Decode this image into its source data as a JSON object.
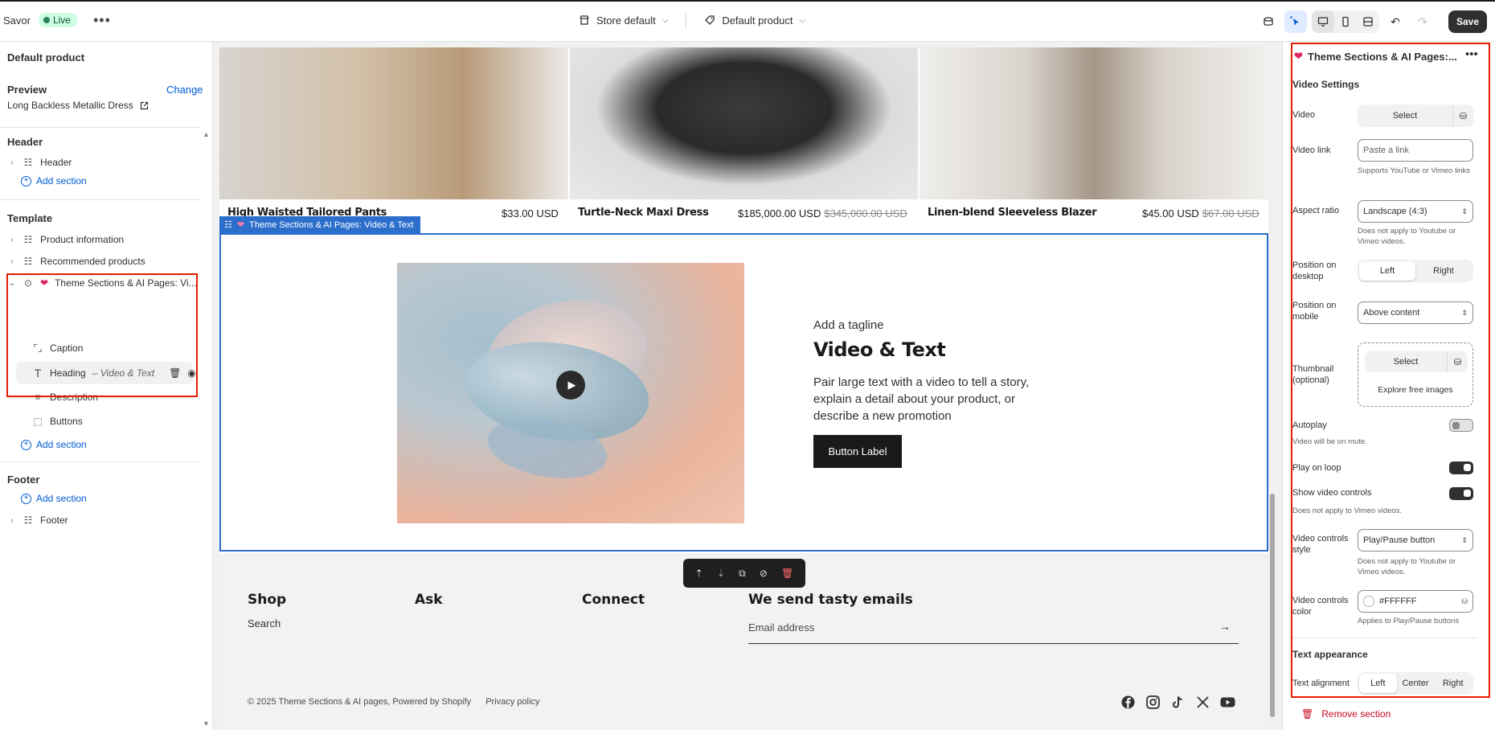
{
  "topbar": {
    "theme_name": "Savor",
    "status_badge": "Live",
    "store_dropdown": "Store default",
    "template_dropdown": "Default product",
    "save_label": "Save"
  },
  "left_panel": {
    "title": "Default product",
    "preview_label": "Preview",
    "change_label": "Change",
    "preview_product": "Long Backless Metallic Dress",
    "header_group": "Header",
    "header_item": "Header",
    "add_section": "Add section",
    "template_group": "Template",
    "template_items": [
      "Product information",
      "Recommended products",
      "Theme Sections & AI Pages: Vi..."
    ],
    "blocks": [
      {
        "label": "Caption"
      },
      {
        "label": "Heading",
        "suffix": "– Video & Text"
      },
      {
        "label": "Description"
      },
      {
        "label": "Buttons"
      }
    ],
    "footer_group": "Footer",
    "footer_item": "Footer"
  },
  "canvas": {
    "products": [
      {
        "name": "High Waisted Tailored Pants",
        "price": "$33.00 USD",
        "compare": ""
      },
      {
        "name": "Turtle-Neck Maxi Dress",
        "price": "$185,000.00 USD",
        "compare": "$345,000.00 USD"
      },
      {
        "name": "Linen-blend Sleeveless Blazer",
        "price": "$45.00 USD",
        "compare": "$67.00 USD"
      }
    ],
    "section_tag": "Theme Sections & AI Pages: Video & Text",
    "tagline": "Add a tagline",
    "heading": "Video & Text",
    "description": "Pair large text with a video to tell a story, explain a detail about your product, or describe a new promotion",
    "button_label": "Button Label",
    "footer": {
      "col_shop": "Shop",
      "shop_link": "Search",
      "col_ask": "Ask",
      "col_connect": "Connect",
      "col_emails": "We send tasty emails",
      "email_placeholder": "Email address",
      "copyright": "© 2025 Theme Sections & AI pages, Powered by Shopify",
      "privacy": "Privacy policy",
      "socials": [
        "facebook-icon",
        "instagram-icon",
        "tiktok-icon",
        "x-icon",
        "youtube-icon"
      ]
    }
  },
  "right_panel": {
    "title": "Theme Sections & AI Pages:...",
    "video_settings": "Video Settings",
    "video_label": "Video",
    "select_label": "Select",
    "video_link_label": "Video link",
    "video_link_placeholder": "Paste a link",
    "video_link_hint": "Supports YouTube or Vimeo links",
    "aspect_label": "Aspect ratio",
    "aspect_value": "Landscape (4:3)",
    "aspect_hint": "Does not apply to Youtube or Vimeo videos.",
    "pos_desktop_label": "Position on desktop",
    "pos_left": "Left",
    "pos_right": "Right",
    "pos_mobile_label": "Position on mobile",
    "pos_mobile_value": "Above content",
    "thumb_label": "Thumbnail (optional)",
    "thumb_select": "Select",
    "thumb_explore": "Explore free images",
    "autoplay_label": "Autoplay",
    "autoplay_hint": "Video will be on mute.",
    "loop_label": "Play on loop",
    "controls_label": "Show video controls",
    "controls_hint": "Does not apply to Vimeo videos.",
    "controls_style_label": "Video controls style",
    "controls_style_value": "Play/Pause button",
    "controls_style_hint": "Does not apply to Youtube or Vimeo videos.",
    "controls_color_label": "Video controls color",
    "controls_color_value": "#FFFFFF",
    "controls_color_hint": "Applies to Play/Pause buttons",
    "text_appearance": "Text appearance",
    "text_align_label": "Text alignment",
    "align_left": "Left",
    "align_center": "Center",
    "align_right": "Right",
    "remove_section": "Remove section",
    "toggles": {
      "autoplay": false,
      "loop": true,
      "controls": true
    }
  },
  "colors": {
    "accent": "#2c6ecb",
    "highlight": "#e51c00",
    "live": "#29845a",
    "danger": "#c70a24"
  }
}
